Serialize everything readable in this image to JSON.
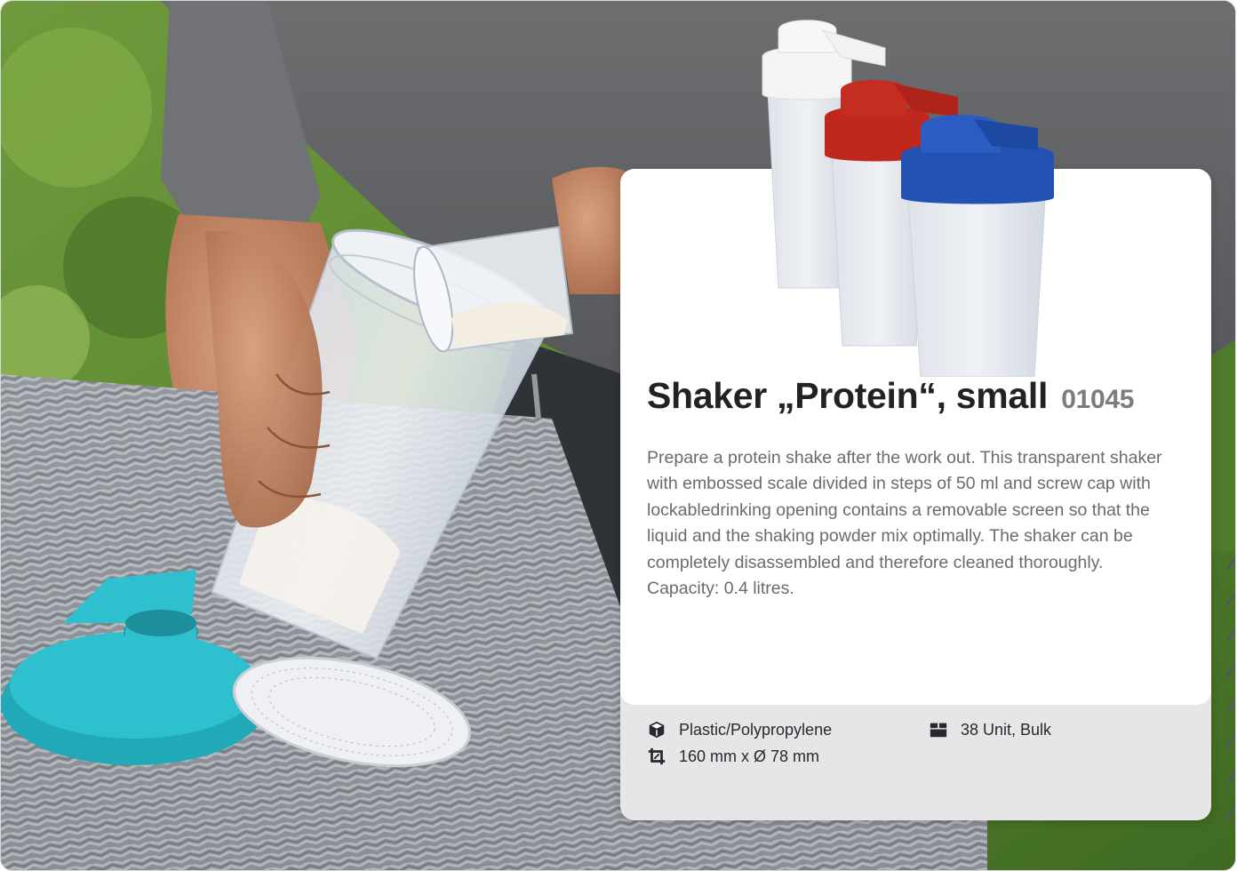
{
  "product": {
    "name": "Shaker „Protein“, small",
    "code": "01045",
    "description": "Prepare a protein shake after the work out. This transparent shaker with embossed scale divided in steps of 50 ml and screw cap with lockabledrinking opening contains a removable screen so that the liquid and the shaking powder mix optimally. The shaker can be completely disassembled and therefore cleaned thoroughly. Capacity: 0.4 litres.",
    "colors": [
      "#f2f2f0",
      "#c0281e",
      "#2352b3"
    ]
  },
  "specs": {
    "material": {
      "icon": "cube-icon",
      "text": "Plastic/Polypropylene"
    },
    "dimensions": {
      "icon": "crop-icon",
      "text": "160 mm x Ø 78 mm"
    },
    "packaging": {
      "icon": "box-icon",
      "text": "38 Unit, Bulk"
    }
  },
  "theme": {
    "accent_cap": "#2fc0cf",
    "card_footer": "#e6e6e8",
    "deco_lines": "#5b3fa0"
  }
}
